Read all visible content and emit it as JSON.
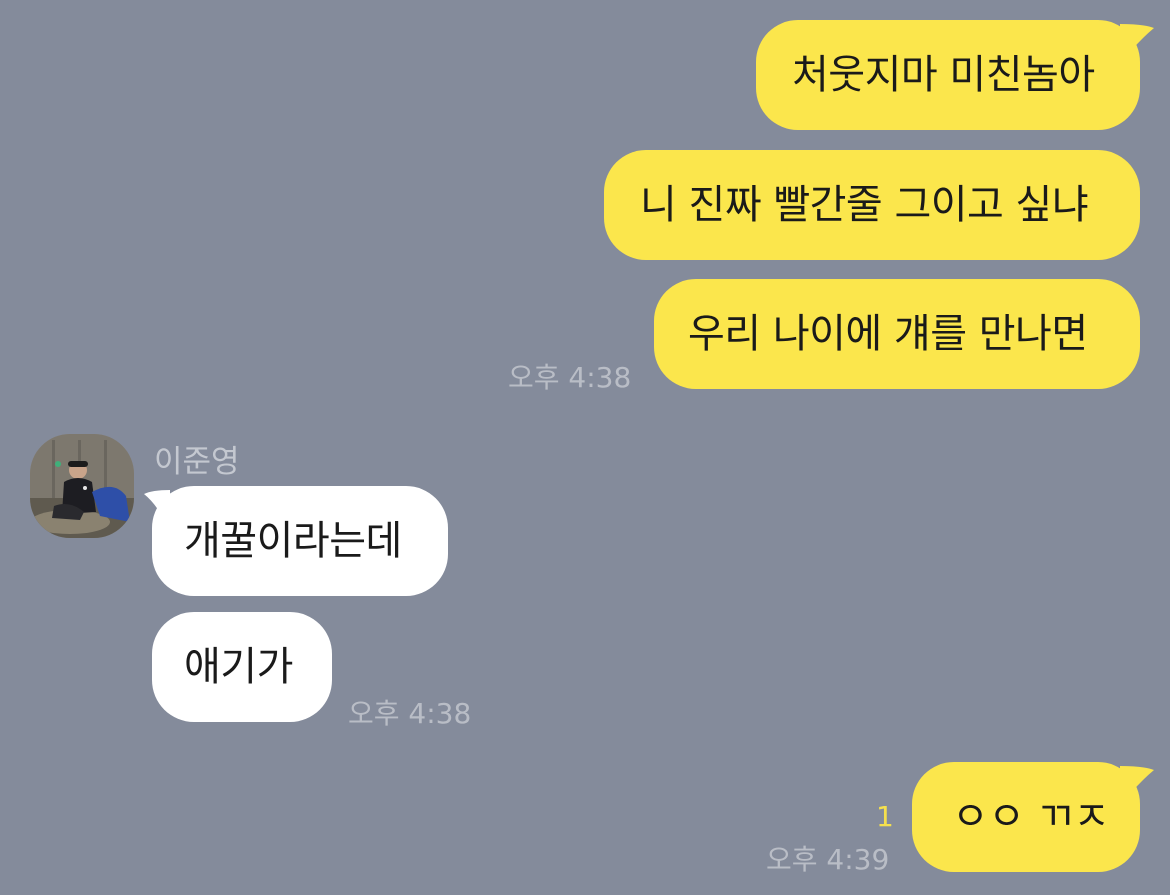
{
  "chat": {
    "messages_out_1": [
      "처웃지마 미친놈아",
      "니 진짜 빨간줄 그이고 싶냐",
      "우리 나이에 걔를 만나면"
    ],
    "time_out_1": "오후 4:38",
    "sender_name": "이준영",
    "messages_in": [
      "개꿀이라는데",
      "애기가"
    ],
    "time_in": "오후 4:38",
    "message_out_2": "ㅇㅇ ㄲㅈ",
    "unread_count": "1",
    "time_out_2": "오후 4:39"
  },
  "colors": {
    "background": "#848b9b",
    "outgoing_bubble": "#fbe64c",
    "incoming_bubble": "#ffffff",
    "timestamp": "#b9bdc6",
    "unread": "#f5e04d"
  }
}
